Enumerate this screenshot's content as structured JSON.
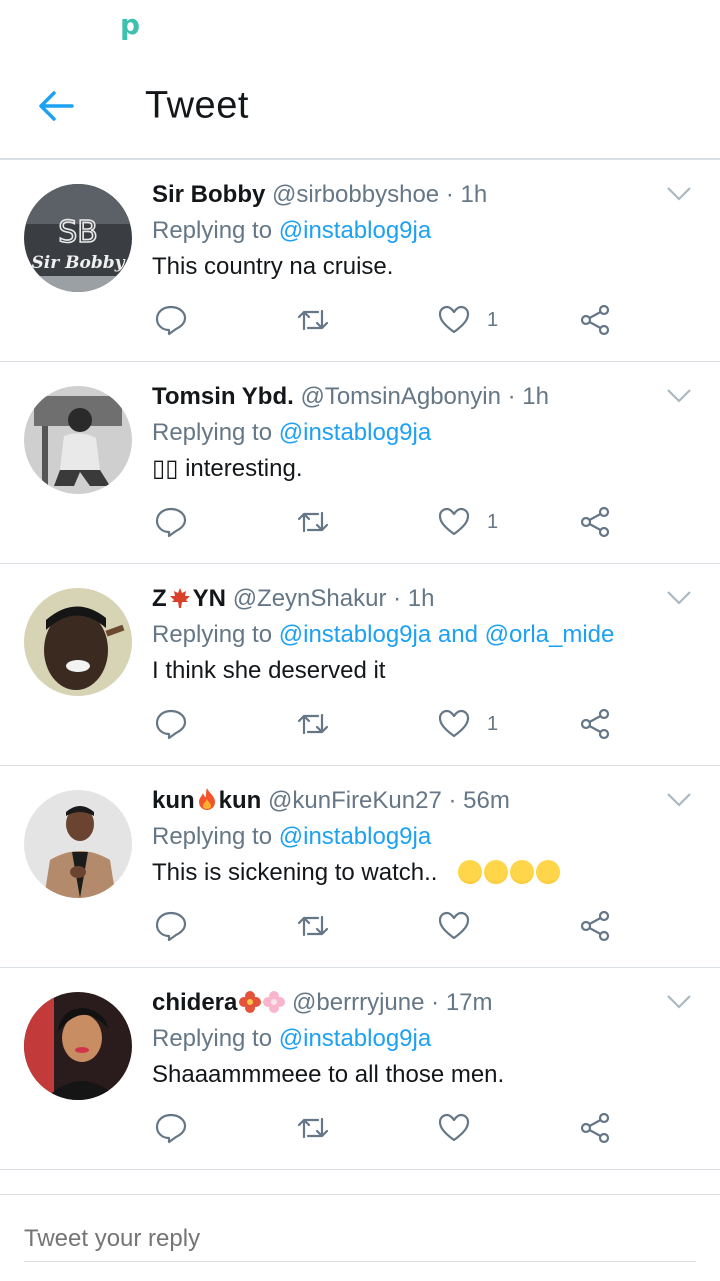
{
  "header": {
    "title": "Tweet"
  },
  "status_bar": {
    "app_glyph": "p"
  },
  "tweets": [
    {
      "name": "Sir Bobby",
      "handle": "@sirbobbyshoe",
      "dot": "·",
      "time": "1h",
      "replying_prefix": "Replying to",
      "mention1": "@instablog9ja",
      "conj": "",
      "mention2": "",
      "text": "This country na cruise.",
      "likes": "1",
      "avatar_text1": "SB",
      "avatar_text2": "Sir Bobby"
    },
    {
      "name": "Tomsin Ybd.",
      "handle": "@TomsinAgbonyin",
      "dot": "·",
      "time": "1h",
      "replying_prefix": "Replying to",
      "mention1": "@instablog9ja",
      "conj": "",
      "mention2": "",
      "text": "▯▯ interesting.",
      "likes": "1"
    },
    {
      "name_a": "Z",
      "name_b": "YN",
      "handle": "@ZeynShakur",
      "dot": "·",
      "time": "1h",
      "replying_prefix": "Replying to",
      "mention1": "@instablog9ja",
      "conj": "and",
      "mention2": "@orla_mide",
      "text": "I think she deserved it",
      "likes": "1"
    },
    {
      "name_a": "kun",
      "name_b": "kun",
      "handle": "@kunFireKun27",
      "dot": "·",
      "time": "56m",
      "replying_prefix": "Replying to",
      "mention1": "@instablog9ja",
      "conj": "",
      "mention2": "",
      "text": "This is sickening to watch..",
      "likes": ""
    },
    {
      "name": "chidera",
      "handle": "@berrryjune",
      "dot": "·",
      "time": "17m",
      "replying_prefix": "Replying to",
      "mention1": "@instablog9ja",
      "conj": "",
      "mention2": "",
      "text": "Shaaammmeee to all those men.",
      "likes": ""
    }
  ],
  "composer": {
    "placeholder": "Tweet your reply"
  },
  "colors": {
    "accent": "#1da1f2",
    "secondary": "#657786",
    "divider": "#d9dfe4"
  },
  "icons": [
    "back-arrow-icon",
    "chevron-down-icon",
    "reply-icon",
    "retweet-icon",
    "like-icon",
    "share-icon",
    "maple-leaf-icon",
    "fire-icon",
    "flower-icon",
    "pleading-face-icon"
  ]
}
